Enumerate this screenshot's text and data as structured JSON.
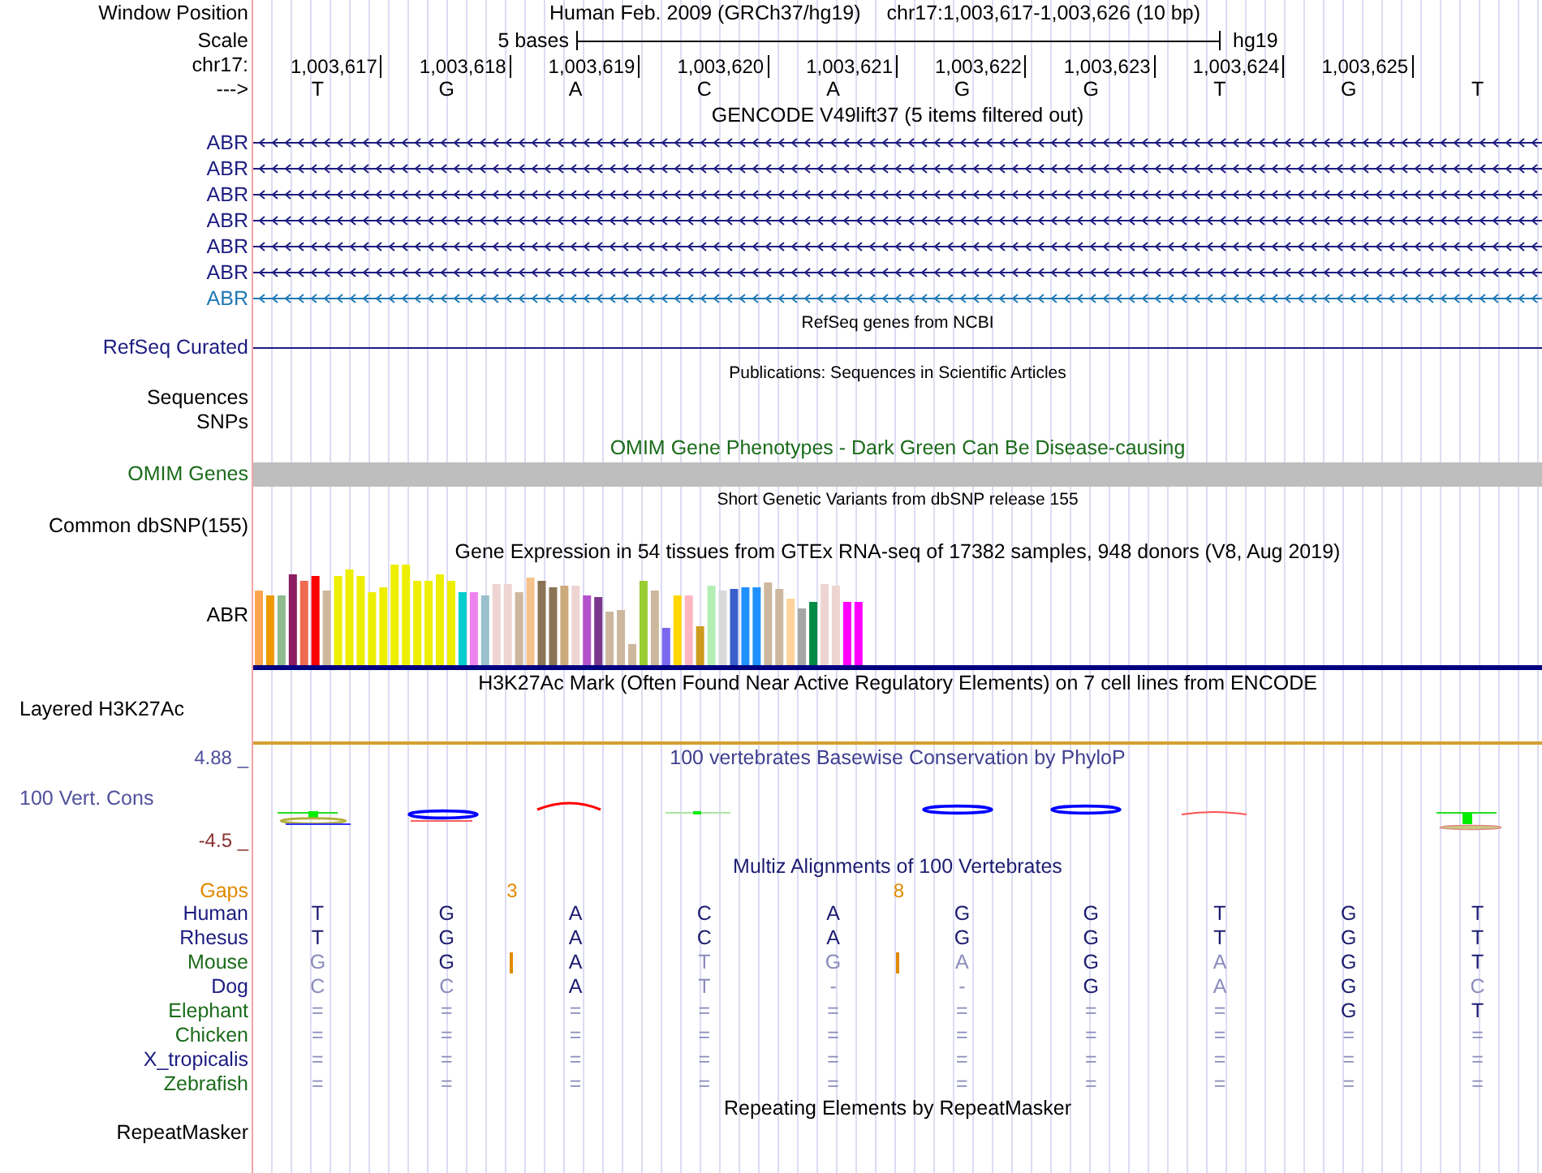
{
  "header": {
    "label": "Window Position",
    "assembly": "Human Feb. 2009 (GRCh37/hg19)",
    "position": "chr17:1,003,617-1,003,626 (10 bp)"
  },
  "scale": {
    "label": "Scale",
    "span": "5 bases",
    "assembly": "hg19"
  },
  "ruler": {
    "label": "chr17:",
    "positions": [
      "1,003,617",
      "1,003,618",
      "1,003,619",
      "1,003,620",
      "1,003,621",
      "1,003,622",
      "1,003,623",
      "1,003,624",
      "1,003,625"
    ]
  },
  "sequence": {
    "label": "--->",
    "bases": [
      "T",
      "G",
      "A",
      "C",
      "A",
      "G",
      "G",
      "T",
      "G",
      "T"
    ]
  },
  "gencode": {
    "title": "GENCODE V49lift37 (5 items filtered out)",
    "items": [
      {
        "label": "ABR",
        "color": "#1c1c80"
      },
      {
        "label": "ABR",
        "color": "#1c1c80"
      },
      {
        "label": "ABR",
        "color": "#1c1c80"
      },
      {
        "label": "ABR",
        "color": "#1c1c80"
      },
      {
        "label": "ABR",
        "color": "#1c1c80"
      },
      {
        "label": "ABR",
        "color": "#1c1c80"
      },
      {
        "label": "ABR",
        "color": "#1f78b4"
      }
    ]
  },
  "refseq": {
    "title": "RefSeq genes from NCBI",
    "label": "RefSeq Curated"
  },
  "publications": {
    "title": "Publications: Sequences in Scientific Articles",
    "labels": [
      "Sequences",
      "SNPs"
    ]
  },
  "omim": {
    "title": "OMIM Gene Phenotypes - Dark Green Can Be Disease-causing",
    "label": "OMIM Genes"
  },
  "dbsnp": {
    "title": "Short Genetic Variants from dbSNP release 155",
    "label": "Common dbSNP(155)"
  },
  "gtex": {
    "title": "Gene Expression in 54 tissues from GTEx RNA-seq of 17382 samples, 948 donors (V8, Aug 2019)",
    "label": "ABR"
  },
  "h3k27ac": {
    "title": "H3K27Ac Mark (Often Found Near Active Regulatory Elements) on 7 cell lines from ENCODE",
    "label": "Layered H3K27Ac"
  },
  "conservation": {
    "title": "100 vertebrates Basewise Conservation by PhyloP",
    "label": "100 Vert. Cons",
    "max": "4.88 _",
    "min": "-4.5 _"
  },
  "multiz": {
    "title": "Multiz Alignments of 100 Vertebrates",
    "gaps": {
      "label": "Gaps",
      "after_column": [
        {
          "gap": false
        },
        {
          "gap": true,
          "count": "3"
        },
        {
          "gap": false
        },
        {
          "gap": false
        },
        {
          "gap": true,
          "count": "8"
        },
        {
          "gap": false
        },
        {
          "gap": false
        },
        {
          "gap": false
        },
        {
          "gap": false
        },
        {
          "gap": false
        }
      ]
    },
    "species": [
      {
        "name": "Human",
        "color": "#1c1c80",
        "insert_after": [
          false,
          false,
          false,
          false,
          false,
          false,
          false,
          false,
          false,
          false
        ],
        "cells": [
          {
            "text": "T",
            "match": true
          },
          {
            "text": "G",
            "match": true
          },
          {
            "text": "A",
            "match": true
          },
          {
            "text": "C",
            "match": true
          },
          {
            "text": "A",
            "match": true
          },
          {
            "text": "G",
            "match": true
          },
          {
            "text": "G",
            "match": true
          },
          {
            "text": "T",
            "match": true
          },
          {
            "text": "G",
            "match": true
          },
          {
            "text": "T",
            "match": true
          }
        ]
      },
      {
        "name": "Rhesus",
        "color": "#1c1c80",
        "insert_after": [
          false,
          false,
          false,
          false,
          false,
          false,
          false,
          false,
          false,
          false
        ],
        "cells": [
          {
            "text": "T",
            "match": true
          },
          {
            "text": "G",
            "match": true
          },
          {
            "text": "A",
            "match": true
          },
          {
            "text": "C",
            "match": true
          },
          {
            "text": "A",
            "match": true
          },
          {
            "text": "G",
            "match": true
          },
          {
            "text": "G",
            "match": true
          },
          {
            "text": "T",
            "match": true
          },
          {
            "text": "G",
            "match": true
          },
          {
            "text": "T",
            "match": true
          }
        ]
      },
      {
        "name": "Mouse",
        "color": "#1a6b1a",
        "insert_after": [
          false,
          true,
          false,
          false,
          true,
          false,
          false,
          false,
          false,
          false
        ],
        "cells": [
          {
            "text": "G",
            "match": false
          },
          {
            "text": "G",
            "match": true
          },
          {
            "text": "A",
            "match": true
          },
          {
            "text": "T",
            "match": false
          },
          {
            "text": "G",
            "match": false
          },
          {
            "text": "A",
            "match": false
          },
          {
            "text": "G",
            "match": true
          },
          {
            "text": "A",
            "match": false
          },
          {
            "text": "G",
            "match": true
          },
          {
            "text": "T",
            "match": true
          }
        ]
      },
      {
        "name": "Dog",
        "color": "#1c1c80",
        "insert_after": [
          false,
          false,
          false,
          false,
          false,
          false,
          false,
          false,
          false,
          false
        ],
        "cells": [
          {
            "text": "C",
            "match": false
          },
          {
            "text": "C",
            "match": false
          },
          {
            "text": "A",
            "match": true
          },
          {
            "text": "T",
            "match": false
          },
          {
            "text": "-",
            "match": false
          },
          {
            "text": "-",
            "match": false
          },
          {
            "text": "G",
            "match": true
          },
          {
            "text": "A",
            "match": false
          },
          {
            "text": "G",
            "match": true
          },
          {
            "text": "C",
            "match": false
          }
        ]
      },
      {
        "name": "Elephant",
        "color": "#1a6b1a",
        "insert_after": [
          false,
          false,
          false,
          false,
          false,
          false,
          false,
          false,
          false,
          false
        ],
        "cells": [
          {
            "text": "=",
            "match": false
          },
          {
            "text": "=",
            "match": false
          },
          {
            "text": "=",
            "match": false
          },
          {
            "text": "=",
            "match": false
          },
          {
            "text": "=",
            "match": false
          },
          {
            "text": "=",
            "match": false
          },
          {
            "text": "=",
            "match": false
          },
          {
            "text": "=",
            "match": false
          },
          {
            "text": "G",
            "match": true
          },
          {
            "text": "T",
            "match": true
          }
        ]
      },
      {
        "name": "Chicken",
        "color": "#1a6b1a",
        "insert_after": [
          false,
          false,
          false,
          false,
          false,
          false,
          false,
          false,
          false,
          false
        ],
        "cells": [
          {
            "text": "=",
            "match": false
          },
          {
            "text": "=",
            "match": false
          },
          {
            "text": "=",
            "match": false
          },
          {
            "text": "=",
            "match": false
          },
          {
            "text": "=",
            "match": false
          },
          {
            "text": "=",
            "match": false
          },
          {
            "text": "=",
            "match": false
          },
          {
            "text": "=",
            "match": false
          },
          {
            "text": "=",
            "match": false
          },
          {
            "text": "=",
            "match": false
          }
        ]
      },
      {
        "name": "X_tropicalis",
        "color": "#1c1c80",
        "insert_after": [
          false,
          false,
          false,
          false,
          false,
          false,
          false,
          false,
          false,
          false
        ],
        "cells": [
          {
            "text": "=",
            "match": false
          },
          {
            "text": "=",
            "match": false
          },
          {
            "text": "=",
            "match": false
          },
          {
            "text": "=",
            "match": false
          },
          {
            "text": "=",
            "match": false
          },
          {
            "text": "=",
            "match": false
          },
          {
            "text": "=",
            "match": false
          },
          {
            "text": "=",
            "match": false
          },
          {
            "text": "=",
            "match": false
          },
          {
            "text": "=",
            "match": false
          }
        ]
      },
      {
        "name": "Zebrafish",
        "color": "#1a6b1a",
        "insert_after": [
          false,
          false,
          false,
          false,
          false,
          false,
          false,
          false,
          false,
          false
        ],
        "cells": [
          {
            "text": "=",
            "match": false
          },
          {
            "text": "=",
            "match": false
          },
          {
            "text": "=",
            "match": false
          },
          {
            "text": "=",
            "match": false
          },
          {
            "text": "=",
            "match": false
          },
          {
            "text": "=",
            "match": false
          },
          {
            "text": "=",
            "match": false
          },
          {
            "text": "=",
            "match": false
          },
          {
            "text": "=",
            "match": false
          },
          {
            "text": "=",
            "match": false
          }
        ]
      }
    ]
  },
  "repeatmasker": {
    "title": "Repeating Elements by RepeatMasker",
    "label": "RepeatMasker"
  }
}
